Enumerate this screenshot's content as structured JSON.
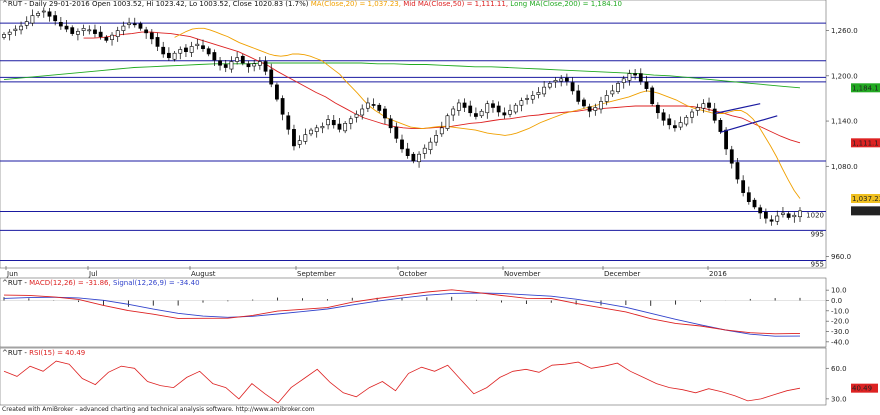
{
  "header": {
    "symbol": "^RUT",
    "info": " - Daily 29-01-2016 Open 1003.52, Hi 1023.42, Lo 1003.52, Close 1020.83 (1.7%)",
    "ma20": "MA(Close,20) = 1,037.23,",
    "ma50": "Mid MA(Close,50) = 1,111.11,",
    "ma200": "Long MA(Close,200) = 1,184.10"
  },
  "macd_header": {
    "symbol": "^RUT",
    "macd": "MACD(12,26) = -31.86,",
    "signal": "Signal(12,26,9) = -34.40"
  },
  "rsi_header": {
    "symbol": "^RUT",
    "rsi": "RSI(15) = 40.49"
  },
  "footer": "Created with AmiBroker - advanced charting and technical analysis software. http://www.amibroker.com",
  "colors": {
    "ma20": "#f0a000",
    "ma50": "#dd2222",
    "ma200": "#22aa22",
    "hlines": "#1a1aa0",
    "macd": "#dd2222",
    "signal": "#3344cc",
    "hist": "#000000",
    "rsi": "#dd2222"
  },
  "chart_data": [
    {
      "type": "candlestick",
      "title": "^RUT Daily",
      "x_labels": [
        "Jun",
        "Jul",
        "August",
        "September",
        "October",
        "November",
        "December",
        "2016"
      ],
      "ylim": [
        945,
        1290
      ],
      "y_ticks": [
        1260,
        1200,
        1140,
        1080,
        960
      ],
      "y_tick_labels": [
        "1,260.0",
        "1,200.0",
        "1,140.0",
        "1,080.0",
        "960.0"
      ],
      "horizontal_levels": [
        1270,
        1220,
        1198,
        1192,
        1087,
        1020,
        995,
        955
      ],
      "level_labels": [
        {
          "value": 1020,
          "label": "1020"
        },
        {
          "value": 995,
          "label": "995"
        },
        {
          "value": 955,
          "label": "955"
        }
      ],
      "value_tags": [
        {
          "label": "1,184.1",
          "bg": "#22aa22",
          "fg": "#000000",
          "value": 1184.1
        },
        {
          "label": "1,111.1",
          "bg": "#dd2222",
          "fg": "#000000",
          "value": 1111.1
        },
        {
          "label": "1,037.23",
          "bg": "#f0c020",
          "fg": "#000000",
          "value": 1037.23
        },
        {
          "label": "1,020.83",
          "bg": "#222222",
          "fg": "#ffffff",
          "value": 1020.83
        }
      ],
      "close": [
        1255,
        1258,
        1262,
        1266,
        1272,
        1280,
        1283,
        1286,
        1279,
        1273,
        1266,
        1262,
        1256,
        1259,
        1263,
        1261,
        1256,
        1252,
        1247,
        1254,
        1260,
        1266,
        1270,
        1268,
        1263,
        1257,
        1249,
        1239,
        1229,
        1224,
        1230,
        1235,
        1232,
        1239,
        1242,
        1236,
        1229,
        1221,
        1214,
        1211,
        1219,
        1224,
        1217,
        1212,
        1216,
        1219,
        1206,
        1189,
        1169,
        1149,
        1129,
        1107,
        1114,
        1122,
        1128,
        1131,
        1133,
        1142,
        1135,
        1129,
        1137,
        1143,
        1149,
        1156,
        1164,
        1161,
        1154,
        1144,
        1131,
        1117,
        1103,
        1094,
        1087,
        1096,
        1104,
        1112,
        1121,
        1131,
        1147,
        1156,
        1164,
        1158,
        1151,
        1146,
        1153,
        1163,
        1158,
        1152,
        1148,
        1154,
        1161,
        1167,
        1170,
        1174,
        1178,
        1185,
        1190,
        1194,
        1196,
        1193,
        1180,
        1166,
        1160,
        1153,
        1158,
        1166,
        1174,
        1180,
        1190,
        1196,
        1203,
        1201,
        1193,
        1183,
        1163,
        1151,
        1141,
        1135,
        1131,
        1138,
        1145,
        1152,
        1158,
        1163,
        1158,
        1141,
        1126,
        1103,
        1084,
        1063,
        1045,
        1033,
        1026,
        1018,
        1011,
        1007,
        1014,
        1018,
        1012,
        1015,
        1020.83
      ],
      "ma20": [
        1251,
        1255,
        1259,
        1262,
        1263,
        1263,
        1261,
        1258,
        1255,
        1252,
        1248,
        1244,
        1241,
        1238,
        1235,
        1232,
        1229,
        1227,
        1226,
        1227,
        1229,
        1229,
        1228,
        1226,
        1223,
        1220,
        1214,
        1208,
        1202,
        1193,
        1185,
        1177,
        1168,
        1160,
        1154,
        1149,
        1144,
        1141,
        1138,
        1135,
        1132,
        1131,
        1130,
        1131,
        1132,
        1133,
        1133,
        1132,
        1131,
        1130,
        1129,
        1128,
        1126,
        1124,
        1123,
        1122,
        1121,
        1122,
        1124,
        1127,
        1130,
        1134,
        1138,
        1141,
        1144,
        1147,
        1150,
        1152,
        1154,
        1156,
        1158,
        1160,
        1162,
        1164,
        1166,
        1168,
        1170,
        1172,
        1175,
        1178,
        1180,
        1179,
        1177,
        1174,
        1171,
        1168,
        1164,
        1160,
        1157,
        1155,
        1153,
        1151,
        1150,
        1150,
        1152,
        1154,
        1154,
        1150,
        1143,
        1133,
        1120,
        1107,
        1093,
        1077,
        1062,
        1048,
        1037.23
      ],
      "ma50": [
        1250,
        1250,
        1251,
        1253,
        1255,
        1256,
        1258,
        1258,
        1257,
        1256,
        1254,
        1252,
        1248,
        1244,
        1240,
        1236,
        1232,
        1226,
        1220,
        1214,
        1206,
        1199,
        1192,
        1185,
        1178,
        1172,
        1164,
        1157,
        1150,
        1144,
        1140,
        1136,
        1133,
        1131,
        1130,
        1130,
        1131,
        1132,
        1133,
        1135,
        1137,
        1138,
        1140,
        1142,
        1143,
        1145,
        1147,
        1148,
        1150,
        1151,
        1152,
        1153,
        1155,
        1156,
        1157,
        1158,
        1159,
        1160,
        1160,
        1160,
        1160,
        1160,
        1160,
        1159,
        1157,
        1154,
        1151,
        1147,
        1144,
        1138,
        1132,
        1126,
        1120,
        1115,
        1111.11
      ],
      "ma200": [
        1195,
        1197,
        1199,
        1201,
        1203,
        1205,
        1207,
        1209,
        1211,
        1212,
        1213,
        1214,
        1215,
        1216,
        1216,
        1216,
        1217,
        1217,
        1217,
        1217,
        1217,
        1217,
        1217,
        1216,
        1216,
        1215,
        1215,
        1214,
        1213,
        1212,
        1212,
        1211,
        1210,
        1209,
        1208,
        1207,
        1206,
        1205,
        1204,
        1203,
        1201,
        1200,
        1198,
        1196,
        1194,
        1192,
        1190,
        1188,
        1186,
        1184.1
      ],
      "rising_wedge": [
        [
          1138,
          1150
        ],
        [
          1163,
          1176
        ],
        [
          1125,
          1170
        ]
      ]
    },
    {
      "type": "macd",
      "title": "MACD(12,26) / Signal(12,26,9)",
      "ylim": [
        -44,
        14
      ],
      "y_ticks": [
        10,
        0,
        -10,
        -20,
        -30,
        -40
      ],
      "y_tick_labels": [
        "10.0",
        "0.0",
        "-10.0",
        "-20.0",
        "-30.0",
        "-40.0"
      ],
      "macd": [
        5.2,
        4.9,
        3.5,
        1.0,
        -4.8,
        -9.8,
        -13.3,
        -17.3,
        -17.2,
        -17.1,
        -14.4,
        -10.3,
        -8.5,
        -6.9,
        -1.7,
        1.9,
        5.0,
        8.2,
        10.3,
        7.8,
        4.8,
        2.1,
        1.9,
        -2.8,
        -7.0,
        -11.0,
        -17.6,
        -22.2,
        -24.7,
        -28.4,
        -31.1,
        -32.2,
        -31.86
      ],
      "signal": [
        2.0,
        2.8,
        3.2,
        2.5,
        0.2,
        -3.7,
        -8.3,
        -12.4,
        -15.1,
        -16.3,
        -15.3,
        -13.1,
        -10.7,
        -8.2,
        -4.3,
        -0.7,
        2.5,
        5.1,
        6.8,
        7.2,
        6.8,
        5.5,
        4.1,
        1.2,
        -2.3,
        -6.6,
        -12.4,
        -18.2,
        -23.5,
        -28.5,
        -32.6,
        -34.5,
        -34.4
      ]
    },
    {
      "type": "line",
      "title": "RSI(15)",
      "ylim": [
        24,
        72
      ],
      "y_ticks": [
        60,
        30
      ],
      "y_tick_labels": [
        "60.0",
        "30.0"
      ],
      "value_tag": {
        "label": "40.49",
        "value": 40.49
      },
      "series": [
        {
          "values": [
            57,
            52,
            62,
            57,
            67,
            64,
            50,
            44,
            56,
            62,
            60,
            47,
            43,
            41,
            51,
            57,
            45,
            41,
            30,
            45,
            35,
            26,
            41,
            50,
            59,
            46,
            36,
            32,
            41,
            47,
            38,
            55,
            61,
            57,
            63,
            49,
            35,
            41,
            51,
            57,
            59,
            56,
            63,
            64,
            66,
            60,
            62,
            65,
            57,
            51,
            45,
            41,
            39,
            36,
            40,
            37,
            33,
            28,
            30,
            34,
            38,
            40.49
          ]
        }
      ]
    }
  ]
}
